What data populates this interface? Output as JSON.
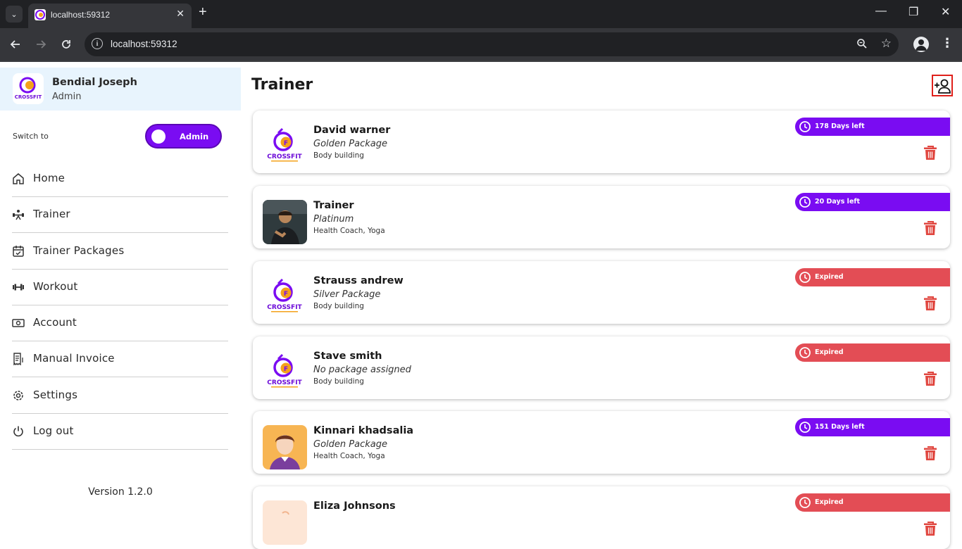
{
  "browser": {
    "tab_title": "localhost:59312",
    "url": "localhost:59312",
    "new_tab_symbol": "+",
    "close_symbol": "✕",
    "minimize_symbol": "—",
    "restore_symbol": "❐",
    "window_close_symbol": "✕"
  },
  "sidebar": {
    "user_name": "Bendial Joseph",
    "user_role": "Admin",
    "switch_label": "Switch to",
    "switch_text": "Admin",
    "menu": [
      {
        "label": "Home",
        "icon": "home-icon"
      },
      {
        "label": "Trainer",
        "icon": "trainer-icon"
      },
      {
        "label": "Trainer Packages",
        "icon": "calendar-check-icon"
      },
      {
        "label": "Workout",
        "icon": "dumbbell-icon"
      },
      {
        "label": "Account",
        "icon": "money-icon"
      },
      {
        "label": "Manual Invoice",
        "icon": "invoice-icon"
      },
      {
        "label": "Settings",
        "icon": "gear-icon"
      },
      {
        "label": "Log out",
        "icon": "power-icon"
      }
    ],
    "version": "Version 1.2.0"
  },
  "main": {
    "title": "Trainer",
    "trainers": [
      {
        "name": "David warner",
        "package": "Golden Package",
        "specialty": "Body building",
        "status": "178 Days left",
        "expired": false,
        "avatar": "crossfit-logo"
      },
      {
        "name": "Trainer",
        "package": "Platinum",
        "specialty": "Health Coach, Yoga",
        "status": "20 Days left",
        "expired": false,
        "avatar": "photo"
      },
      {
        "name": "Strauss andrew",
        "package": "Silver Package",
        "specialty": "Body building",
        "status": "Expired",
        "expired": true,
        "avatar": "crossfit-logo"
      },
      {
        "name": "Stave smith",
        "package": "No package assigned",
        "specialty": "Body building",
        "status": "Expired",
        "expired": true,
        "avatar": "crossfit-logo"
      },
      {
        "name": "Kinnari khadsalia",
        "package": "Golden Package",
        "specialty": "Health Coach, Yoga",
        "status": "151 Days left",
        "expired": false,
        "avatar": "cartoon"
      },
      {
        "name": "Eliza Johnsons",
        "package": "",
        "specialty": "",
        "status": "Expired",
        "expired": true,
        "avatar": "partial"
      }
    ]
  },
  "colors": {
    "accent": "#7a0cf2",
    "expired": "#e34d55",
    "delete": "#e0463f",
    "profile_bg": "#e8f4fd"
  }
}
